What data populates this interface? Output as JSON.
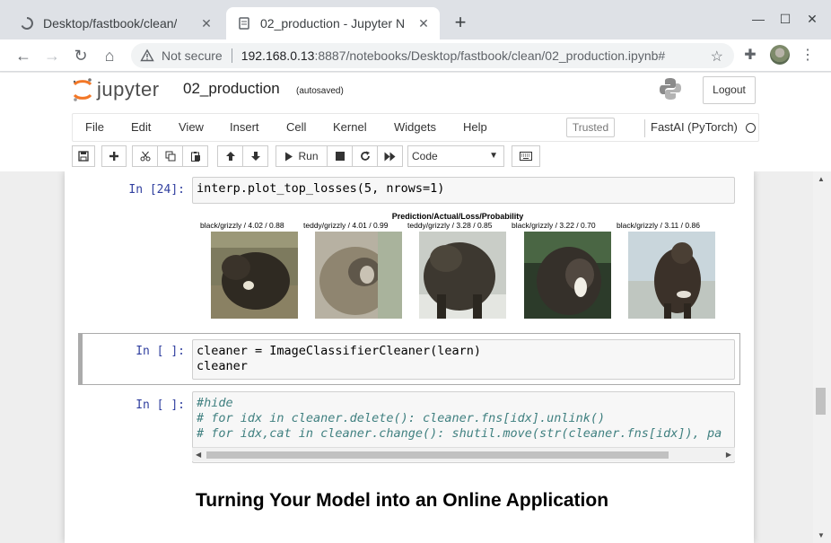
{
  "browser": {
    "tabs": [
      {
        "title": "Desktop/fastbook/clean/",
        "active": false
      },
      {
        "title": "02_production - Jupyter N",
        "active": true
      }
    ],
    "new_tab": "+",
    "window_controls": {
      "minimize": "—",
      "maximize": "☐",
      "close": "✕"
    },
    "security_label": "Not secure",
    "url_host": "192.168.0.13",
    "url_rest": ":8887/notebooks/Desktop/fastbook/clean/02_production.ipynb#"
  },
  "jupyter": {
    "logo_text": "jupyter",
    "notebook_name": "02_production",
    "autosave_status": "(autosaved)",
    "logout_label": "Logout",
    "menu": [
      "File",
      "Edit",
      "View",
      "Insert",
      "Cell",
      "Kernel",
      "Widgets",
      "Help"
    ],
    "trusted_label": "Trusted",
    "kernel_name": "FastAI (PyTorch)",
    "toolbar": {
      "run_label": "Run",
      "cell_type": "Code"
    }
  },
  "cells": [
    {
      "prompt": "In [24]:",
      "code": [
        "interp.plot_top_losses(5, nrows=1)"
      ],
      "output": {
        "title": "Prediction/Actual/Loss/Probability",
        "labels": [
          "black/grizzly / 4.02 / 0.88",
          "teddy/grizzly / 4.01 / 0.99",
          "teddy/grizzly / 3.28 / 0.85",
          "black/grizzly / 3.22 / 0.70",
          "black/grizzly / 3.11 / 0.86"
        ]
      }
    },
    {
      "prompt": "In [ ]:",
      "code": [
        "cleaner = ImageClassifierCleaner(learn)",
        "cleaner"
      ]
    },
    {
      "prompt": "In [ ]:",
      "code": [
        "#hide",
        "# for idx in cleaner.delete(): cleaner.fns[idx].unlink()",
        "# for idx,cat in cleaner.change(): shutil.move(str(cleaner.fns[idx]), pa"
      ]
    }
  ],
  "markdown_heading": "Turning Your Model into an Online Application",
  "colors": {
    "prompt_blue": "#303f9f",
    "comment_green": "#408080",
    "cell_bg": "#f7f7f7"
  }
}
